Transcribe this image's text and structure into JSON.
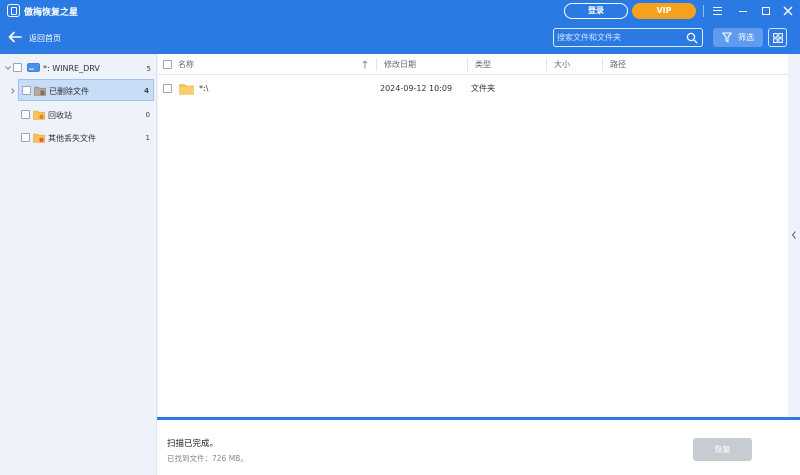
{
  "app": {
    "title": "傲梅恢复之星",
    "login_label": "登录",
    "vip_label": "VIP"
  },
  "nav": {
    "back_label": "返回首页",
    "search_placeholder": "搜索文件和文件夹",
    "filter_label": "筛选"
  },
  "tree": {
    "root": {
      "label": "*: WINRE_DRV",
      "count": "5"
    },
    "items": [
      {
        "label": "已删除文件",
        "count": "4",
        "icon": "deleted-folder-icon",
        "selected": true
      },
      {
        "label": "回收站",
        "count": "0",
        "icon": "recycle-bin-icon",
        "selected": false
      },
      {
        "label": "其他丢失文件",
        "count": "1",
        "icon": "lost-files-icon",
        "selected": false
      }
    ]
  },
  "table": {
    "columns": [
      "名称",
      "修改日期",
      "类型",
      "大小",
      "路径"
    ],
    "rows": [
      {
        "name": "*:\\",
        "modified": "2024-09-12 10:09",
        "type": "文件夹",
        "size": "",
        "path": ""
      }
    ]
  },
  "footer": {
    "status": "扫描已完成。",
    "found": "已找到文件：726 MB。",
    "recover_label": "恢复"
  },
  "colors": {
    "accent": "#2b79e3",
    "vip": "#f8a21c",
    "folder": "#f6c35a"
  }
}
